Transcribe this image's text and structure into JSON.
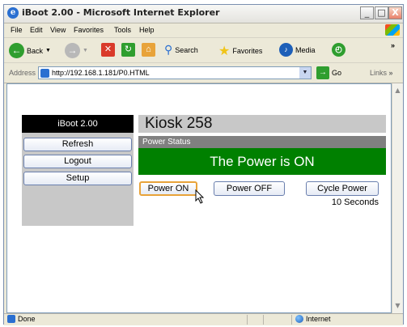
{
  "window": {
    "title": "iBoot 2.00 - Microsoft Internet Explorer",
    "controls": [
      "_",
      "□",
      "X"
    ]
  },
  "menu": {
    "items": [
      "File",
      "Edit",
      "View",
      "Favorites",
      "Tools",
      "Help"
    ]
  },
  "toolbar": {
    "back_label": "Back",
    "search_label": "Search",
    "favorites_label": "Favorites",
    "media_label": "Media",
    "overflow": "»"
  },
  "address": {
    "label": "Address",
    "url": "http://192.168.1.181/P0.HTML",
    "go_label": "Go",
    "links_label": "Links"
  },
  "page": {
    "device_name": "iBoot 2.00",
    "title": "Kiosk 258",
    "sidebar_buttons": [
      "Refresh",
      "Logout",
      "Setup"
    ],
    "status_label": "Power Status",
    "status_text": "The Power is ON",
    "status_color": "#008000",
    "power_buttons": [
      "Power ON",
      "Power OFF",
      "Cycle Power"
    ],
    "cycle_delay": "10 Seconds"
  },
  "statusbar": {
    "status": "Done",
    "zone": "Internet"
  }
}
